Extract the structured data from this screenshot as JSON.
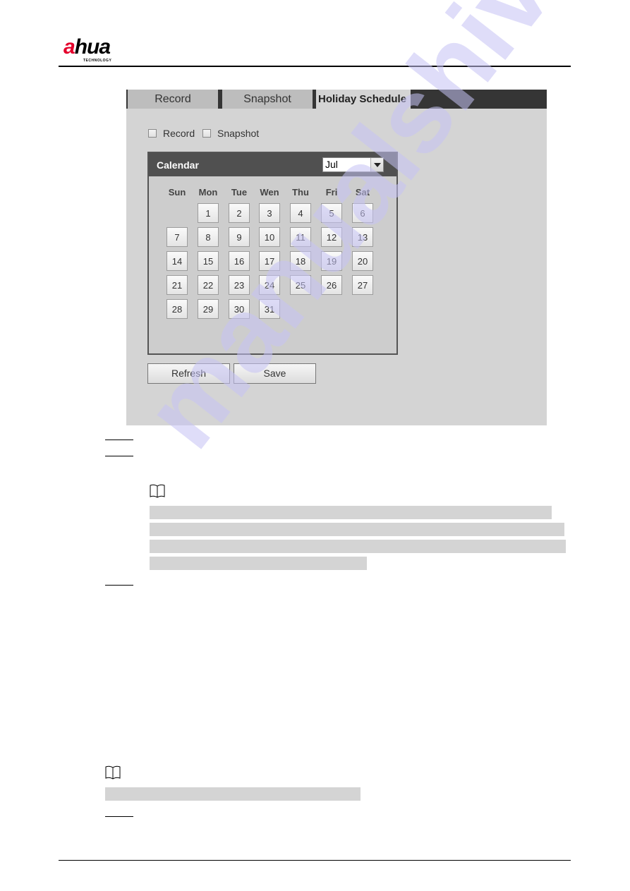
{
  "header": {
    "brand": {
      "part1": "a",
      "part2": "hua",
      "sub": "TECHNOLOGY"
    },
    "brand_color": "#e4002b"
  },
  "ui": {
    "tabs": [
      {
        "label": "Record",
        "active": false
      },
      {
        "label": "Snapshot",
        "active": false
      },
      {
        "label": "Holiday Schedule",
        "active": true
      }
    ],
    "checkboxes": [
      {
        "label": "Record",
        "checked": false
      },
      {
        "label": "Snapshot",
        "checked": false
      }
    ],
    "calendar": {
      "title": "Calendar",
      "month_select": {
        "value": "Jul"
      },
      "weekdays": [
        "Sun",
        "Mon",
        "Tue",
        "Wen",
        "Thu",
        "Fri",
        "Sat"
      ],
      "first_weekday_index": 1,
      "days": [
        "1",
        "2",
        "3",
        "4",
        "5",
        "6",
        "7",
        "8",
        "9",
        "10",
        "11",
        "12",
        "13",
        "14",
        "15",
        "16",
        "17",
        "18",
        "19",
        "20",
        "21",
        "22",
        "23",
        "24",
        "25",
        "26",
        "27",
        "28",
        "29",
        "30",
        "31"
      ]
    },
    "buttons": {
      "refresh": "Refresh",
      "save": "Save"
    }
  },
  "watermark": "manualshive"
}
